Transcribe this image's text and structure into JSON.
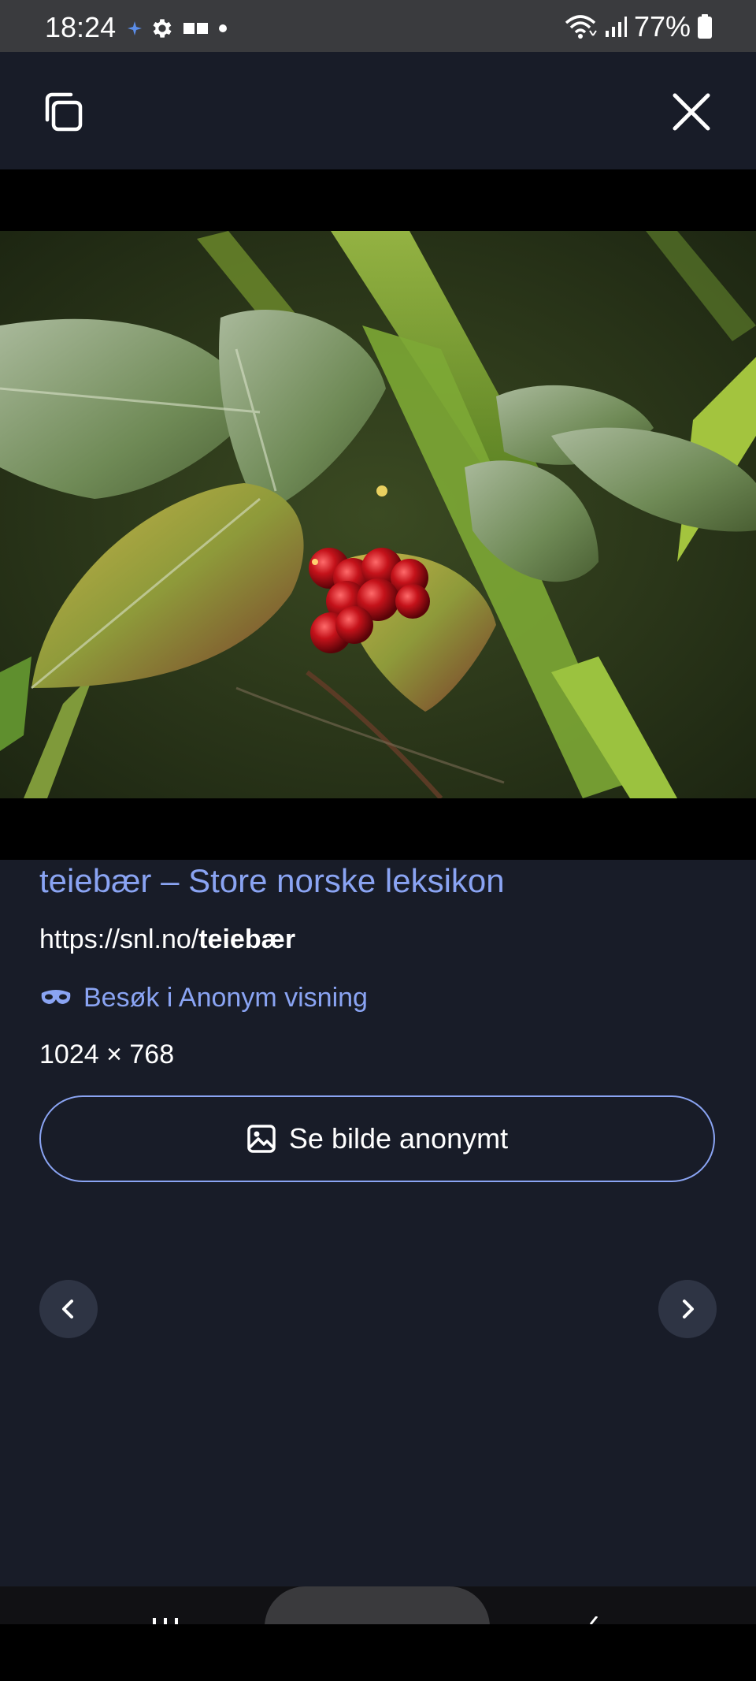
{
  "status_bar": {
    "time": "18:24",
    "battery": "77%",
    "left_icons": [
      "assistant-sparkle-icon",
      "settings-icon",
      "gallery-icon",
      "dot-icon"
    ],
    "right_icons": [
      "wifi-icon",
      "signal-icon",
      "battery-icon"
    ]
  },
  "toolbar": {
    "copy_icon": "copy-icon",
    "close_icon": "close-icon"
  },
  "image": {
    "subject": "cloudberry plant with red berries"
  },
  "result": {
    "title": "teiebær – Store norske leksikon",
    "url_prefix": "https://snl.no/",
    "url_bold": "teiebær",
    "visit_label": "Besøk i Anonym visning",
    "dimensions": "1024 × 768",
    "anon_button_label": "Se bilde anonymt"
  },
  "colors": {
    "accent": "#8aa4f3",
    "background": "#181c28",
    "nav_button": "#2e3444"
  }
}
